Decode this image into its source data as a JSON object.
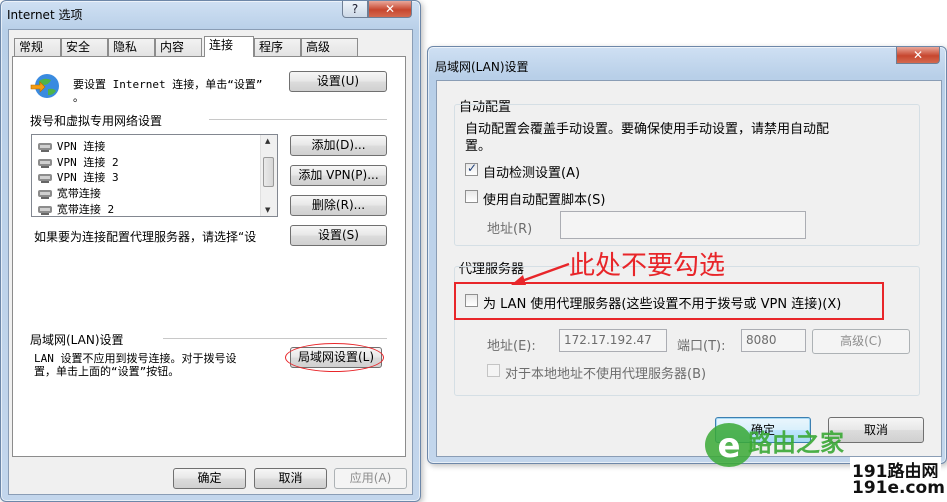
{
  "left_dialog": {
    "title": "Internet 选项",
    "help_btn": "?",
    "close_btn": "✕",
    "tabs": [
      "常规",
      "安全",
      "隐私",
      "内容",
      "连接",
      "程序",
      "高级"
    ],
    "setup_text_1": "要设置 Internet 连接，单击“设置”",
    "setup_text_2": "。",
    "setup_button": "设置(U)",
    "dialup_header": "拨号和虚拟专用网络设置",
    "connections": [
      "VPN 连接",
      "VPN 连接 2",
      "VPN 连接 3",
      "宽带连接",
      "宽带连接 2"
    ],
    "add_button": "添加(D)...",
    "add_vpn_button": "添加 VPN(P)...",
    "remove_button": "删除(R)...",
    "proxy_hint": "如果要为连接配置代理服务器，请选择“设",
    "settings_button": "设置(S)",
    "lan_header": "局域网(LAN)设置",
    "lan_text_1": "LAN 设置不应用到拨号连接。对于拨号设",
    "lan_text_2": "置，单击上面的“设置”按钮。",
    "lan_button": "局域网设置(L)",
    "ok": "确定",
    "cancel": "取消",
    "apply": "应用(A)"
  },
  "right_dialog": {
    "title": "局域网(LAN)设置",
    "close_btn": "✕",
    "auto_header": "自动配置",
    "auto_desc_1": "自动配置会覆盖手动设置。要确保使用手动设置，请禁用自动配",
    "auto_desc_2": "置。",
    "auto_detect": "自动检测设置(A)",
    "auto_detect_checked": true,
    "auto_script": "使用自动配置脚本(S)",
    "auto_script_checked": false,
    "address_label": "地址(R)",
    "proxy_header": "代理服务器",
    "annotation": "此处不要勾选",
    "use_proxy": "为 LAN 使用代理服务器(这些设置不用于拨号或 VPN 连接)(X)",
    "use_proxy_checked": false,
    "proxy_address_label": "地址(E):",
    "proxy_address": "172.17.192.47",
    "port_label": "端口(T):",
    "port": "8080",
    "advanced": "高级(C)",
    "bypass_local": "对于本地地址不使用代理服务器(B)",
    "ok": "确定",
    "cancel": "取消"
  },
  "watermark": {
    "brand": "路由之家",
    "site_1": "191路由网",
    "site_2": "191e.com"
  },
  "colors": {
    "annotation_red": "#e8262a",
    "watermark_green": "#3aa935"
  }
}
